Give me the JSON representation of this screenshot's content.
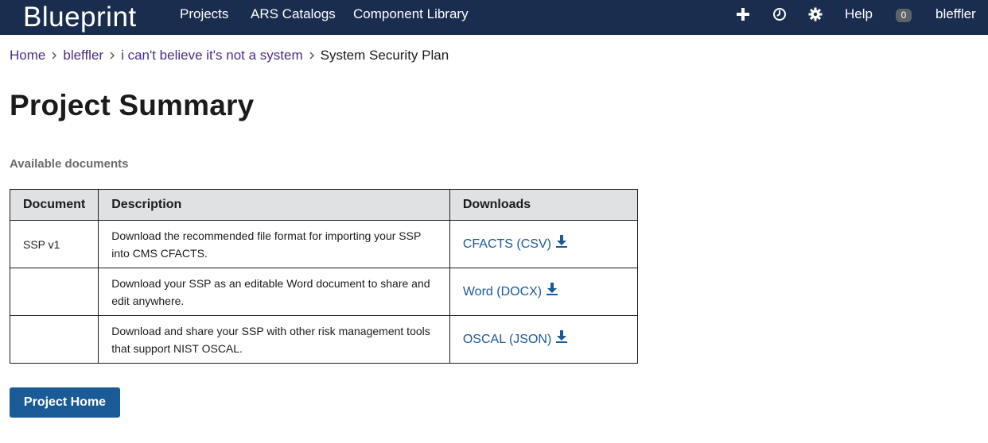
{
  "nav": {
    "brand": "Blueprint",
    "links": [
      "Projects",
      "ARS Catalogs",
      "Component Library"
    ],
    "icons": [
      "plus-icon",
      "clock-icon",
      "gear-icon"
    ],
    "help": "Help",
    "badge_count": "0",
    "username": "bleffler"
  },
  "breadcrumb": {
    "items": [
      "Home",
      "bleffler",
      "i can't believe it's not a system"
    ],
    "current": "System Security Plan"
  },
  "page": {
    "title": "Project Summary",
    "section_label": "Available documents"
  },
  "table": {
    "headers": [
      "Document",
      "Description",
      "Downloads"
    ],
    "rows": [
      {
        "document": "SSP v1",
        "description": "Download the recommended file format for importing your SSP into CMS CFACTS.",
        "download": "CFACTS (CSV)"
      },
      {
        "document": "",
        "description": "Download your SSP as an editable Word document to share and edit anywhere.",
        "download": "Word (DOCX)"
      },
      {
        "document": "",
        "description": "Download and share your SSP with other risk management tools that support NIST OSCAL.",
        "download": "OSCAL (JSON)"
      }
    ]
  },
  "actions": {
    "project_home": "Project Home"
  },
  "colors": {
    "nav_bg": "#1a2d4f",
    "link": "#1a5a96",
    "breadcrumb_link": "#4a2d84",
    "header_bg": "#dfe1e2"
  }
}
